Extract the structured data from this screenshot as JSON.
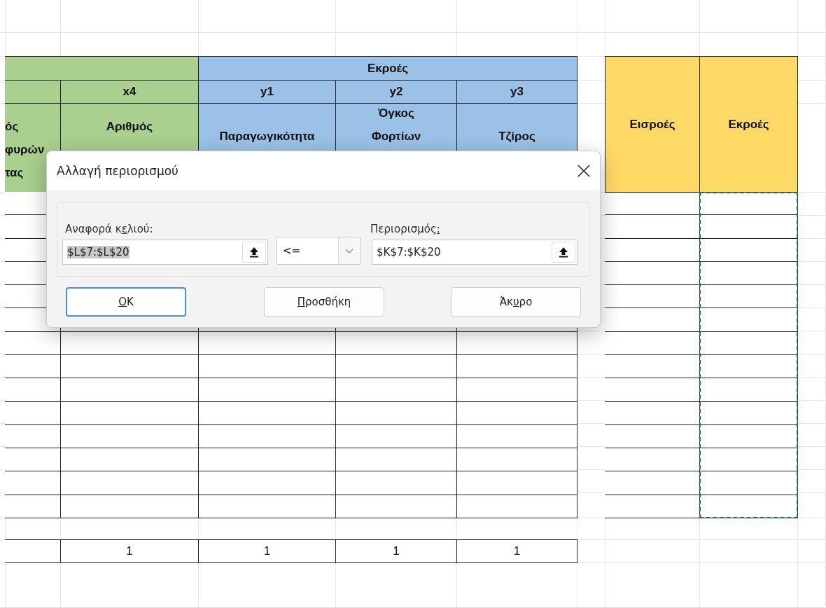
{
  "sheet": {
    "output_group_label": "Εκροές",
    "columns": [
      {
        "color": "#a9d08e",
        "name_lines": [
          "ός",
          "φυρών",
          "τας"
        ]
      },
      {
        "color": "#a9d08e",
        "code": "x4",
        "name_lines": [
          "Αριθμός"
        ],
        "total": "1"
      },
      {
        "color": "#9bc2e6",
        "code": "y1",
        "name_lines": [
          "Παραγωγικότητα"
        ],
        "total": "1"
      },
      {
        "color": "#9bc2e6",
        "code": "y2",
        "name_lines": [
          "Όγκος",
          "Φορτίων"
        ],
        "total": "1"
      },
      {
        "color": "#9bc2e6",
        "code": "y3",
        "name_lines": [
          "Τζίρος"
        ],
        "total": "1"
      }
    ],
    "side_table": {
      "columns": [
        {
          "label": "Εισροές",
          "selected": false
        },
        {
          "label": "Εκροές",
          "selected": true
        }
      ]
    }
  },
  "dialog": {
    "title": "Αλλαγή περιορισμού",
    "cell_reference": {
      "label": "Αναφορά κελιού:",
      "value": "$L$7:$L$20",
      "value_selected": true
    },
    "operator": "<=",
    "constraint": {
      "label": "Περιορισμός:",
      "value": "$K$7:$K$20",
      "value_selected": false
    },
    "buttons": [
      {
        "label": "OK",
        "default": true
      },
      {
        "label": "Προσθήκη",
        "default": false
      },
      {
        "label": "Άκυρο",
        "default": false
      }
    ]
  }
}
